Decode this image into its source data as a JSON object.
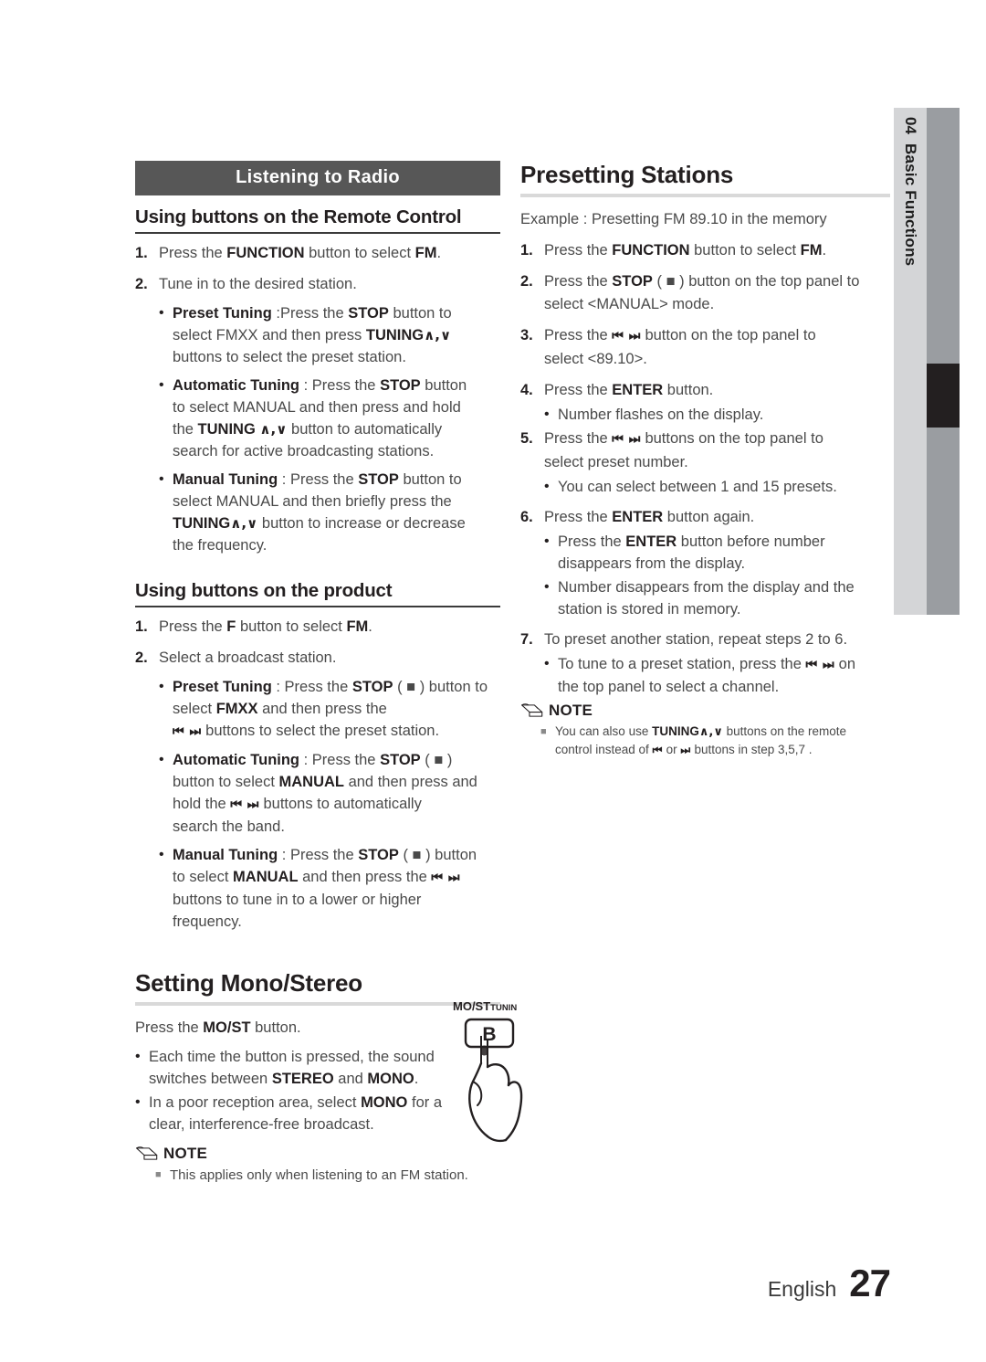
{
  "side_tab": {
    "chapter_number": "04",
    "chapter_title": "Basic Functions"
  },
  "left_column": {
    "bar_heading": "Listening to Radio",
    "sub_heading_remote": "Using buttons on the Remote Control",
    "remote_steps": [
      {
        "num": "1.",
        "text_pre": "Press the ",
        "bold1": "FUNCTION",
        "text_mid": " button to select ",
        "bold2": "FM",
        "text_post": "."
      },
      {
        "num": "2.",
        "text_pre": "Tune in to the desired station.",
        "bold1": "",
        "text_mid": "",
        "bold2": "",
        "text_post": ""
      }
    ],
    "remote_bullets": [
      {
        "title": "Preset Tuning",
        "line1_a": " :Press the ",
        "line1_b": "STOP",
        "line1_c": " button to",
        "line2": "select FMXX and then press ",
        "line2_b": "TUNING",
        "line2_carets": "∧,∨",
        "line3": "buttons to select the preset station."
      },
      {
        "title": "Automatic Tuning",
        "line1_a": " : Press the ",
        "line1_b": "STOP",
        "line1_c": " button",
        "line2": "to select MANUAL and then press and hold",
        "line3_a": "the ",
        "line3_b": "TUNING",
        "line3_carets": "∧,∨",
        "line3_c": " button to automatically",
        "line4": "search for active broadcasting stations."
      },
      {
        "title": "Manual Tuning",
        "line1_a": " : Press the ",
        "line1_b": "STOP",
        "line1_c": " button to",
        "line2": "select MANUAL and then briefly press the",
        "line3_b": "TUNING",
        "line3_carets": "∧,∨",
        "line3_c": " button to increase or decrease",
        "line4": "the frequency."
      }
    ],
    "sub_heading_product": "Using buttons on the product",
    "product_steps": [
      {
        "num": "1.",
        "pre": "Press the ",
        "b1": "F",
        "mid": " button to select ",
        "b2": "FM",
        "post": "."
      },
      {
        "num": "2.",
        "pre": "Select a broadcast station.",
        "b1": "",
        "mid": "",
        "b2": "",
        "post": ""
      }
    ],
    "product_bullets": [
      {
        "title": "Preset Tuning",
        "l1_a": " : Press the ",
        "l1_b": "STOP",
        "l1_c": " ( ■ ) button to",
        "l2_a": "select ",
        "l2_b": "FMXX",
        "l2_c": " and then press the",
        "l3_glyph": "⏮ ⏭",
        "l3_c": " buttons to select the preset station."
      },
      {
        "title": "Automatic Tuning",
        "l1_a": " : Press the ",
        "l1_b": "STOP",
        "l1_c": " ( ■ )",
        "l2_a": "button to select ",
        "l2_b": "MANUAL",
        "l2_c": " and then press and",
        "l3_a": "hold the ",
        "l3_glyph": "⏮ ⏭",
        "l3_c": " buttons to automatically",
        "l4": "search the band."
      },
      {
        "title": "Manual Tuning",
        "l1_a": " : Press the ",
        "l1_b": "STOP",
        "l1_c": " ( ■ ) button",
        "l2_a": "to select ",
        "l2_b": "MANUAL",
        "l2_c": " and then press the ",
        "l2_glyph": "⏮ ⏭",
        "l3": "buttons to tune in to a lower or higher",
        "l4": "frequency."
      }
    ],
    "sec_heading_mono": "Setting Mono/Stereo",
    "mono_intro_a": "Press the ",
    "mono_intro_b": "MO/ST",
    "mono_intro_c": " button.",
    "mono_bullets": [
      {
        "l1": "Each time the button is pressed, the sound",
        "l2_a": "switches between ",
        "l2_b": "STEREO",
        "l2_c": " and ",
        "l2_d": "MONO",
        "l2_e": "."
      },
      {
        "l1_a": "In a poor reception area, select ",
        "l1_b": "MONO",
        "l1_c": " for a",
        "l2": "clear, interference-free broadcast."
      }
    ],
    "note_label": "NOTE",
    "note_items": [
      "This applies only when listening to an FM station."
    ],
    "hand_figure": {
      "button_letter": "B",
      "label_main": "MO/ST",
      "label_sub": "TUNIN"
    }
  },
  "right_column": {
    "sec_heading": "Presetting Stations",
    "example_line": "Example : Presetting FM 89.10 in the memory",
    "steps": [
      {
        "num": "1.",
        "pre": "Press the ",
        "b1": "FUNCTION",
        "mid": " button to select ",
        "b2": "FM",
        "post": "."
      },
      {
        "num": "2.",
        "pre": "Press the ",
        "b1": "STOP",
        "mid": " ( ■ ) button on the top panel to",
        "line2": "select <MANUAL> mode."
      },
      {
        "num": "3.",
        "pre": "Press the ",
        "glyph": "⏮ ⏭",
        "mid": "  button on the top panel to",
        "line2": "select <89.10>."
      },
      {
        "num": "4.",
        "pre": "Press the ",
        "b1": "ENTER",
        "mid": " button."
      },
      {
        "num": "5.",
        "pre": "Press the ",
        "glyph": "⏮ ⏭",
        "mid": " buttons on the top panel to",
        "line2": "select preset number."
      },
      {
        "num": "6.",
        "pre": "Press the ",
        "b1": "ENTER",
        "mid": " button again."
      },
      {
        "num": "7.",
        "pre": "To preset another station, repeat steps 2 to 6."
      }
    ],
    "bullets_after_4": [
      "Number flashes on the display."
    ],
    "bullets_after_5": [
      "You can select between 1 and 15 presets."
    ],
    "bullets_after_6": [
      {
        "l1_a": "Press the ",
        "l1_b": "ENTER",
        "l1_c": " button before number",
        "l2": "disappears from the display."
      },
      {
        "l1_a": "Number disappears from the display and the",
        "l2": "station is stored in memory."
      }
    ],
    "bullets_after_7": [
      {
        "l1_a": "To tune to a preset station, press the ",
        "glyph": "⏮ ⏭",
        "l1_c": " on",
        "l2": "the top panel to select a channel."
      }
    ],
    "note_label": "NOTE",
    "note_item": {
      "a": "You can also use ",
      "b": "TUNING",
      "carets": "∧,∨",
      "c": " buttons on the remote",
      "d": "control instead of ",
      "g1": "⏮",
      "e": " or ",
      "g2": "⏭",
      "f": " buttons in step 3,5,7 ."
    }
  },
  "footer": {
    "language": "English",
    "page_number": "27"
  }
}
